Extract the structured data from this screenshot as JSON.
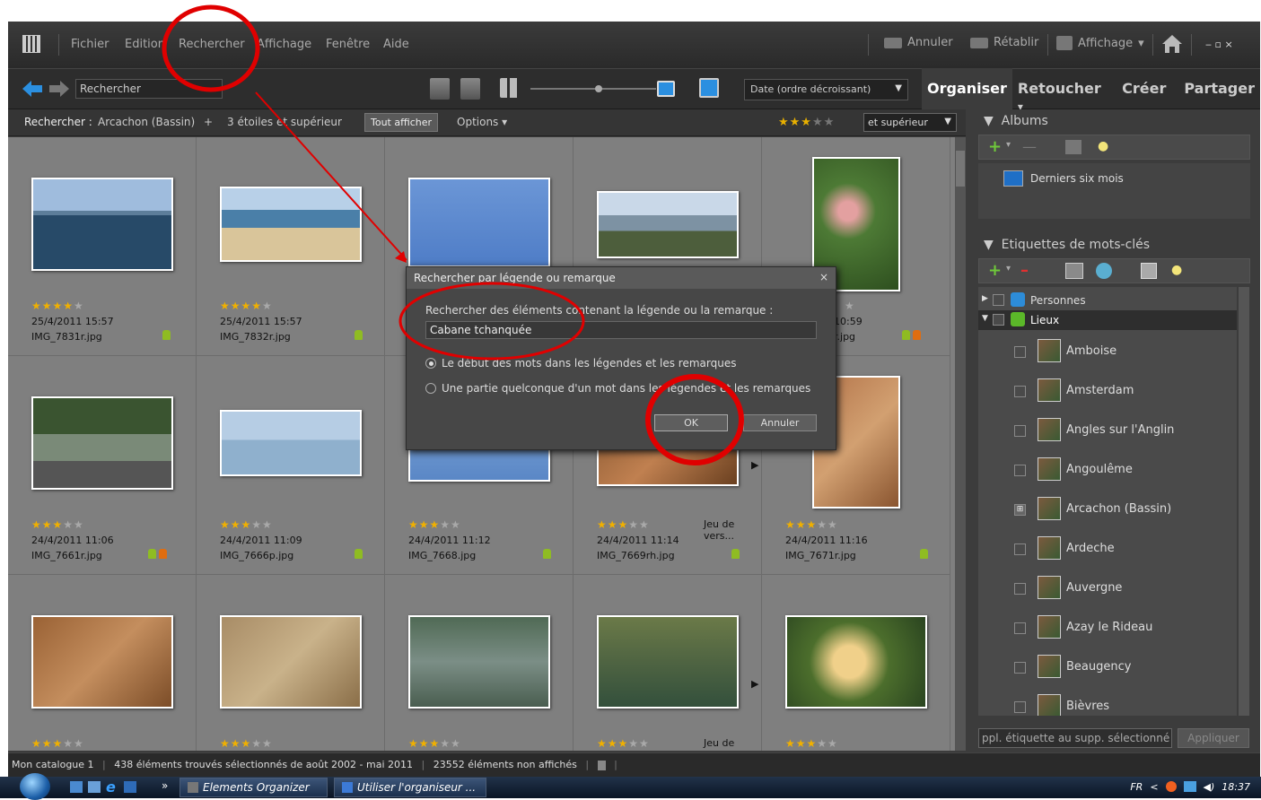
{
  "menubar": {
    "items": [
      "Fichier",
      "Edition",
      "Rechercher",
      "Affichage",
      "Fenêtre",
      "Aide"
    ],
    "undo": "Annuler",
    "redo": "Rétablir",
    "view": "Affichage",
    "window_controls": "‒ ▫ ×"
  },
  "toolbar": {
    "search_value": "Rechercher",
    "sort": "Date (ordre décroissant)"
  },
  "tabs": [
    "Organiser",
    "Retoucher",
    "Créer",
    "Partager"
  ],
  "tab_dropdown": "▾",
  "filterbar": {
    "prefix": "Rechercher :",
    "place": "Arcachon (Bassin)",
    "plus": "+",
    "rating": "3 étoiles et supérieur",
    "show_all": "Tout afficher",
    "options": "Options",
    "stars_on": "★★★",
    "stars_off": "★★",
    "rating_select": "et supérieur"
  },
  "photos": [
    {
      "stars_on": "★★★★",
      "stars_off": "★",
      "date": "25/4/2011 15:57",
      "file": "IMG_7831r.jpg",
      "extra": ""
    },
    {
      "stars_on": "★★★★",
      "stars_off": "★",
      "date": "25/4/2011 15:57",
      "file": "IMG_7832r.jpg",
      "extra": ""
    },
    {
      "stars_on": "",
      "stars_off": "",
      "date": "",
      "file": "",
      "extra": ""
    },
    {
      "stars_on": "",
      "stars_off": "",
      "date": "",
      "file": "",
      "extra": ""
    },
    {
      "stars_on": "",
      "stars_off": "★",
      "date": "10:59",
      "file": "r.jpg",
      "extra": ""
    },
    {
      "stars_on": "★★★",
      "stars_off": "★★",
      "date": "24/4/2011 11:06",
      "file": "IMG_7661r.jpg",
      "extra": ""
    },
    {
      "stars_on": "★★★",
      "stars_off": "★★",
      "date": "24/4/2011 11:09",
      "file": "IMG_7666p.jpg",
      "extra": ""
    },
    {
      "stars_on": "★★★",
      "stars_off": "★★",
      "date": "24/4/2011 11:12",
      "file": "IMG_7668.jpg",
      "extra": ""
    },
    {
      "stars_on": "★★★",
      "stars_off": "★★",
      "date": "24/4/2011 11:14",
      "file": "IMG_7669rh.jpg",
      "extra": "Jeu de vers..."
    },
    {
      "stars_on": "★★★",
      "stars_off": "★★",
      "date": "24/4/2011 11:16",
      "file": "IMG_7671r.jpg",
      "extra": ""
    },
    {
      "stars_on": "★★★",
      "stars_off": "★★",
      "date": "",
      "file": "",
      "extra": ""
    },
    {
      "stars_on": "★★★",
      "stars_off": "★★",
      "date": "",
      "file": "",
      "extra": ""
    },
    {
      "stars_on": "★★★",
      "stars_off": "★★",
      "date": "",
      "file": "",
      "extra": ""
    },
    {
      "stars_on": "★★★",
      "stars_off": "★★",
      "date": "",
      "file": "",
      "extra": "Jeu de vers..."
    },
    {
      "stars_on": "★★★",
      "stars_off": "★★",
      "date": "",
      "file": "",
      "extra": ""
    }
  ],
  "albums": {
    "title": "Albums",
    "items": [
      "Derniers six mois"
    ]
  },
  "keywords": {
    "title": "Etiquettes de mots-clés",
    "people": "Personnes",
    "places": "Lieux",
    "list": [
      "Amboise",
      "Amsterdam",
      "Angles sur l'Anglin",
      "Angoulême",
      "Arcachon (Bassin)",
      "Ardeche",
      "Auvergne",
      "Azay le Rideau",
      "Beaugency",
      "Bièvres"
    ],
    "footer_field": "ppl. étiquette au supp. sélectionné",
    "apply": "Appliquer"
  },
  "dialog": {
    "title": "Rechercher par légende ou remarque",
    "close": "×",
    "label": "Rechercher des éléments contenant la légende ou la remarque :",
    "value": "Cabane tchanquée",
    "option1": "Le début des mots dans les légendes et les remarques",
    "option2": "Une partie quelconque d'un mot dans les légendes et les remarques",
    "ok": "OK",
    "cancel": "Annuler"
  },
  "statusbar": {
    "catalog": "Mon catalogue 1",
    "found": "438 éléments trouvés sélectionnés  de août 2002 - mai 2011",
    "hidden": "23552 éléments non affichés"
  },
  "taskbar": {
    "chevron": "»",
    "task1": "Elements Organizer",
    "task2": "Utiliser l'organiseur ...",
    "lang": "FR",
    "tray_arrow": "<",
    "clock": "18:37"
  },
  "colors": {
    "accent_blue": "#2b8fe0",
    "star": "#f0b000",
    "annotation_red": "#e00000"
  }
}
